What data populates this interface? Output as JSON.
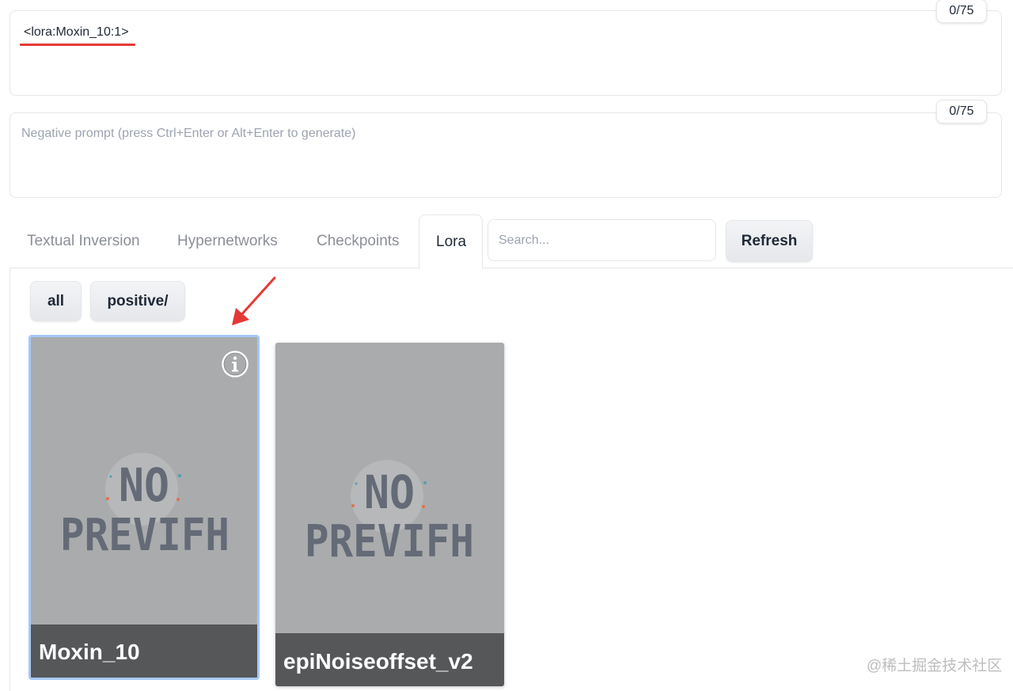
{
  "prompt": {
    "value": "<lora:Moxin_10:1>",
    "token_count": "0/75"
  },
  "negative_prompt": {
    "placeholder": "Negative prompt (press Ctrl+Enter or Alt+Enter to generate)",
    "token_count": "0/75"
  },
  "tabs": [
    {
      "label": "Textual Inversion",
      "active": false
    },
    {
      "label": "Hypernetworks",
      "active": false
    },
    {
      "label": "Checkpoints",
      "active": false
    },
    {
      "label": "Lora",
      "active": true
    }
  ],
  "search": {
    "placeholder": "Search..."
  },
  "refresh_label": "Refresh",
  "filters": [
    {
      "label": "all"
    },
    {
      "label": "positive/"
    }
  ],
  "cards": [
    {
      "name": "Moxin_10",
      "preview_text_1": "NO",
      "preview_text_2": "PREVIFH",
      "selected": true
    },
    {
      "name": "epiNoiseoffset_v2",
      "preview_text_1": "NO",
      "preview_text_2": "PREVIFH",
      "selected": false
    }
  ],
  "watermark": "@稀土掘金技术社区",
  "colors": {
    "annotation_red": "#e53935",
    "selected_border": "#a6c8f5",
    "card_bg": "#a9abad",
    "caption_bg": "#555759"
  }
}
